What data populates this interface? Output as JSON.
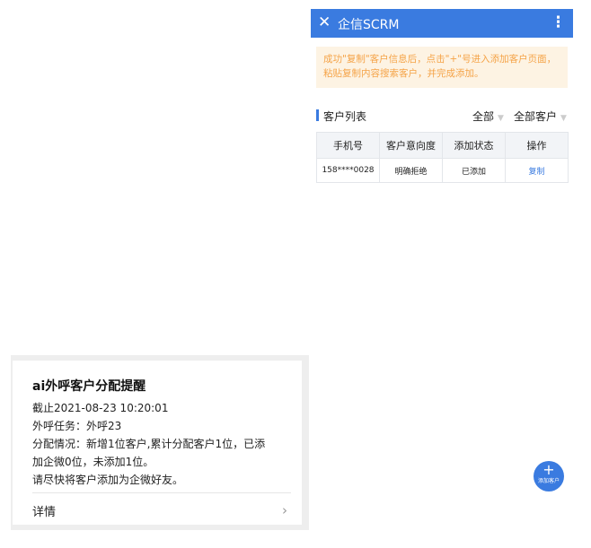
{
  "notification": {
    "title": "ai外呼客户分配提醒",
    "lines": [
      "截止2021-08-23 10:20:01",
      "外呼任务：外呼23",
      "分配情况：新增1位客户,累计分配客户1位，已添",
      "加企微0位，未添加1位。",
      "请尽快将客户添加为企微好友。"
    ],
    "details_label": "详情",
    "chevron": "›"
  },
  "app": {
    "close_icon": "✕",
    "title": "企信SCRM",
    "more_icon": "⋮",
    "notice": "成功\"复制\"客户信息后，点击\"+\"号进入添加客户页面，粘贴复制内容搜索客户，并完成添加。",
    "list": {
      "title": "客户列表",
      "filter_all": "全部",
      "filter_customers": "全部客户",
      "columns": [
        "手机号",
        "客户意向度",
        "添加状态",
        "操作"
      ],
      "rows": [
        {
          "phone": "158****0028",
          "intent": "明确拒绝",
          "status": "已添加",
          "action": "复制"
        }
      ]
    },
    "fab": {
      "plus": "+",
      "label": "添加客户"
    }
  },
  "colors": {
    "primary": "#3a7be0",
    "notice_bg": "#fdf3e3",
    "notice_text": "#f5a347"
  }
}
